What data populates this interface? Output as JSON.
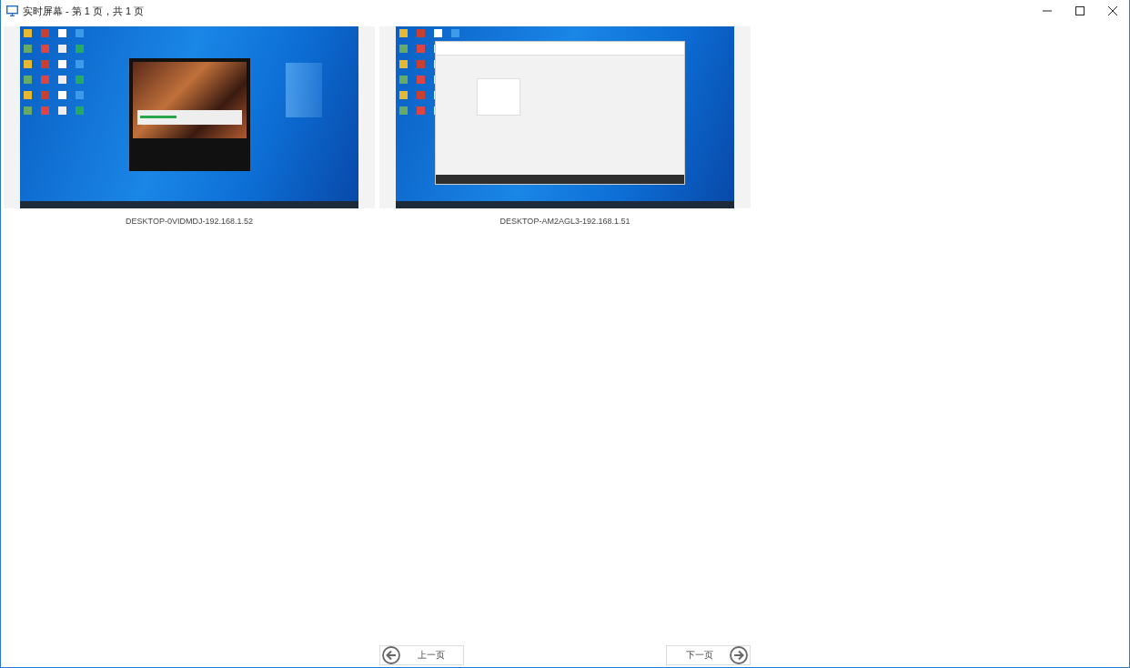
{
  "window": {
    "title": "实时屏幕 - 第 1 页，共 1 页"
  },
  "screens": [
    {
      "label": "DESKTOP-0VIDMDJ-192.168.1.52",
      "kind": "splash"
    },
    {
      "label": "DESKTOP-AM2AGL3-192.168.1.51",
      "kind": "app-window"
    }
  ],
  "pager": {
    "previous": "上一页",
    "next": "下一页"
  }
}
